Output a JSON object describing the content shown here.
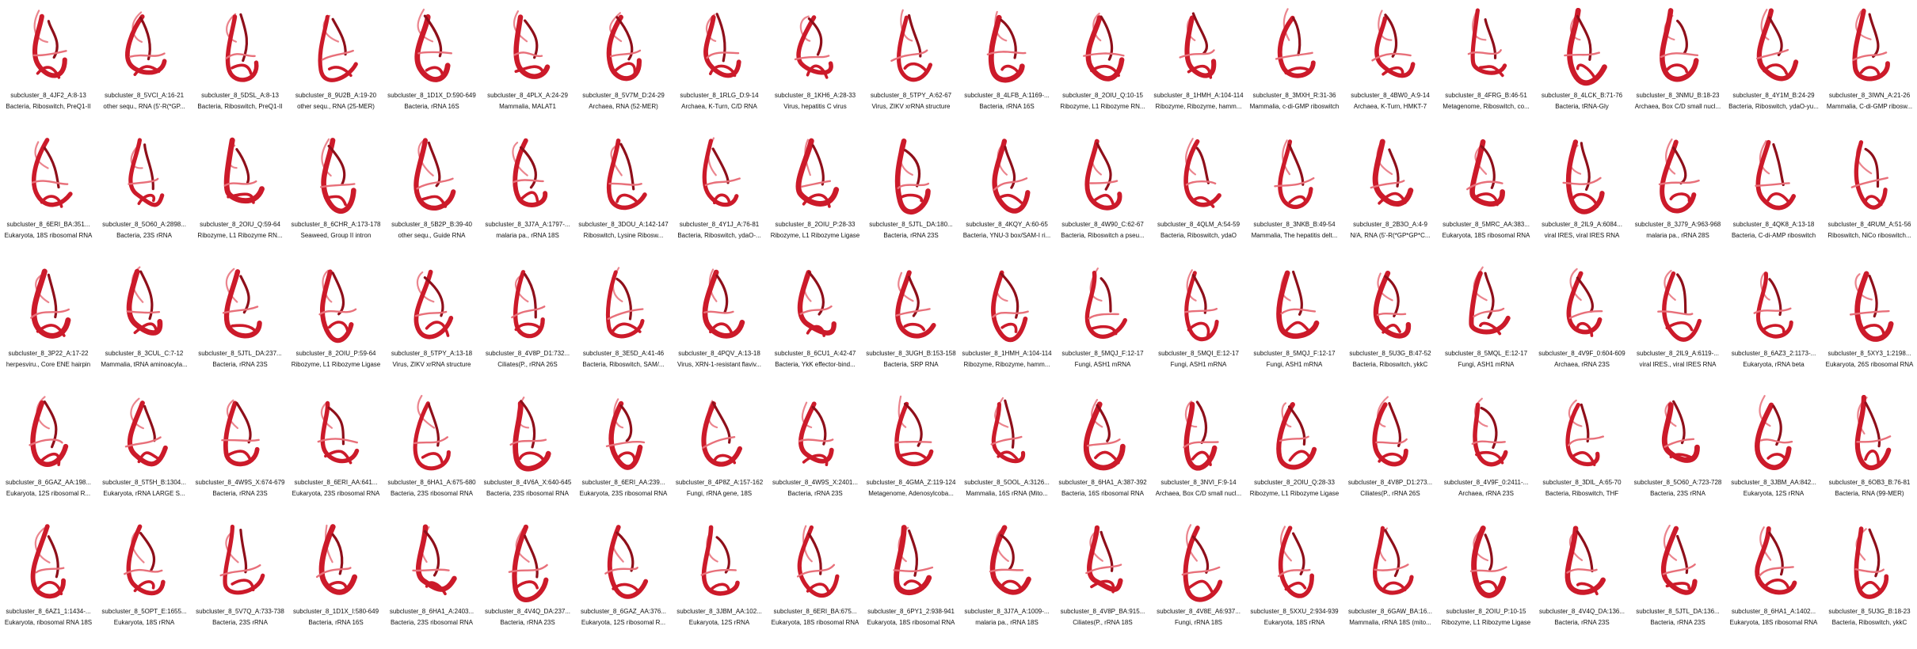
{
  "grid": {
    "cells": [
      {
        "title": "subcluster_8_4JF2_A:8-13",
        "subtitle": "Bacteria, Riboswitch, PreQ1-II"
      },
      {
        "title": "subcluster_8_5VCI_A:16-21",
        "subtitle": "other sequ., RNA (5'-R(*GP..."
      },
      {
        "title": "subcluster_8_5DSL_A:8-13",
        "subtitle": "Bacteria, Riboswitch, PreQ1-II"
      },
      {
        "title": "subcluster_8_9U2B_A:19-20",
        "subtitle": "other sequ., RNA (25-MER)"
      },
      {
        "title": "subcluster_8_1D1X_D:590-649",
        "subtitle": "Bacteria, rRNA 16S"
      },
      {
        "title": "subcluster_8_4PLX_A:24-29",
        "subtitle": "Mammalia, MALAT1"
      },
      {
        "title": "subcluster_8_5V7M_D:24-29",
        "subtitle": "Archaea, RNA (52-MER)"
      },
      {
        "title": "subcluster_8_1RLG_D:9-14",
        "subtitle": "Archaea, K-Turn, C/D RNA"
      },
      {
        "title": "subcluster_8_1KH6_A:28-33",
        "subtitle": "Virus, hepatitis C virus"
      },
      {
        "title": "subcluster_8_5TPY_A:62-67",
        "subtitle": "Virus, ZIKV xrRNA structure"
      },
      {
        "title": "subcluster_8_4LFB_A:1169-...",
        "subtitle": "Bacteria, rRNA 16S"
      },
      {
        "title": "subcluster_8_2OIU_Q:10-15",
        "subtitle": "Ribozyme, L1 Ribozyme RN..."
      },
      {
        "title": "subcluster_8_1HMH_A:104-114",
        "subtitle": "Ribozyme, Ribozyme, hamm..."
      },
      {
        "title": "subcluster_8_3MXH_R:31-36",
        "subtitle": "Mammalia, c-di-GMP riboswitch"
      },
      {
        "title": "subcluster_8_4BW0_A:9-14",
        "subtitle": "Archaea, K-Turn, HMKT-7"
      },
      {
        "title": "subcluster_8_4FRG_B:46-51",
        "subtitle": "Metagenome, Riboswitch, co..."
      },
      {
        "title": "subcluster_8_4LCK_B:71-76",
        "subtitle": "Bacteria, tRNA-Gly"
      },
      {
        "title": "subcluster_8_3NMU_B:18-23",
        "subtitle": "Archaea, Box C/D small nucl..."
      },
      {
        "title": "subcluster_8_4Y1M_B:24-29",
        "subtitle": "Bacteria, Riboswitch, ydaO-yu..."
      },
      {
        "title": "subcluster_8_3IWN_A:21-26",
        "subtitle": "Mammalia, C-di-GMP ribosw..."
      },
      {
        "title": "subcluster_8_6ERI_BA:351...",
        "subtitle": "Eukaryota, 18S ribosomal RNA"
      },
      {
        "title": "subcluster_8_5O60_A:2898...",
        "subtitle": "Bacteria, 23S rRNA"
      },
      {
        "title": "subcluster_8_2OIU_Q:59-64",
        "subtitle": "Ribozyme, L1 Ribozyme RN..."
      },
      {
        "title": "subcluster_8_6CHR_A:173-178",
        "subtitle": "Seaweed, Group II intron"
      },
      {
        "title": "subcluster_8_5B2P_B:39-40",
        "subtitle": "other sequ., Guide RNA"
      },
      {
        "title": "subcluster_8_3J7A_A:1797-...",
        "subtitle": "malaria pa., rRNA 18S"
      },
      {
        "title": "subcluster_8_3DOU_A:142-147",
        "subtitle": "Riboswitch, Lysine Ribosw..."
      },
      {
        "title": "subcluster_8_4Y1J_A:76-81",
        "subtitle": "Bacteria, Riboswitch, ydaO-..."
      },
      {
        "title": "subcluster_8_2OIU_P:28-33",
        "subtitle": "Ribozyme, L1 Ribozyme Ligase"
      },
      {
        "title": "subcluster_8_5JTL_DA:180...",
        "subtitle": "Bacteria, rRNA 23S"
      },
      {
        "title": "subcluster_8_4KQY_A:60-65",
        "subtitle": "Bacteria, YNU-3 box/SAM-I ri..."
      },
      {
        "title": "subcluster_8_4W90_C:62-67",
        "subtitle": "Bacteria, Riboswitch a pseu..."
      },
      {
        "title": "subcluster_8_4QLM_A:54-59",
        "subtitle": "Bacteria, Riboswitch, ydaO"
      },
      {
        "title": "subcluster_8_3NKB_B:49-54",
        "subtitle": "Mammalia, The hepatitis delt..."
      },
      {
        "title": "subcluster_8_2B3O_A:4-9",
        "subtitle": "N/A, RNA (5'-R(*GP*GP*C..."
      },
      {
        "title": "subcluster_8_5MRC_AA:383...",
        "subtitle": "Eukaryota, 18S ribosomal RNA"
      },
      {
        "title": "subcluster_8_2IL9_A:6084...",
        "subtitle": "viral IRES, viral IRES RNA"
      },
      {
        "title": "subcluster_8_3J79_A:963-968",
        "subtitle": "malaria pa., rRNA 28S"
      },
      {
        "title": "subcluster_8_4QK8_A:13-18",
        "subtitle": "Bacteria, C-di-AMP riboswitch"
      },
      {
        "title": "subcluster_8_4RUM_A:51-56",
        "subtitle": "Riboswitch, NiCo riboswitch..."
      },
      {
        "title": "subcluster_8_3P22_A:17-22",
        "subtitle": "herpesviru., Core ENE hairpin"
      },
      {
        "title": "subcluster_8_3CUL_C:7-12",
        "subtitle": "Mammalia, tRNA aminoacyla..."
      },
      {
        "title": "subcluster_8_5JTL_DA:237...",
        "subtitle": "Bacteria, rRNA 23S"
      },
      {
        "title": "subcluster_8_2OIU_P:59-64",
        "subtitle": "Ribozyme, L1 Ribozyme Ligase"
      },
      {
        "title": "subcluster_8_5TPY_A:13-18",
        "subtitle": "Virus, ZIKV xrRNA structure"
      },
      {
        "title": "subcluster_8_4V8P_D1:732...",
        "subtitle": "Ciliates(P., rRNA 26S"
      },
      {
        "title": "subcluster_8_3E5D_A:41-46",
        "subtitle": "Bacteria, Riboswitch, SAM/..."
      },
      {
        "title": "subcluster_8_4PQV_A:13-18",
        "subtitle": "Virus, XRN-1-resistant flaviv..."
      },
      {
        "title": "subcluster_8_6CU1_A:42-47",
        "subtitle": "Bacteria, YkK effector-bind..."
      },
      {
        "title": "subcluster_8_3UGH_B:153-158",
        "subtitle": "Bacteria, SRP RNA"
      },
      {
        "title": "subcluster_8_1HMH_A:104-114",
        "subtitle": "Ribozyme, Ribozyme, hamm..."
      },
      {
        "title": "subcluster_8_5MQJ_F:12-17",
        "subtitle": "Fungi, ASH1 mRNA"
      },
      {
        "title": "subcluster_8_5MQI_E:12-17",
        "subtitle": "Fungi, ASH1 mRNA"
      },
      {
        "title": "subcluster_8_5MQJ_F:12-17",
        "subtitle": "Fungi, ASH1 mRNA"
      },
      {
        "title": "subcluster_8_5U3G_B:47-52",
        "subtitle": "Bacteria, Riboswitch, ykkC"
      },
      {
        "title": "subcluster_8_5MQL_E:12-17",
        "subtitle": "Fungi, ASH1 mRNA"
      },
      {
        "title": "subcluster_8_4V9F_0:604-609",
        "subtitle": "Archaea, rRNA 23S"
      },
      {
        "title": "subcluster_8_2IL9_A:6119-...",
        "subtitle": "viral IRES., viral IRES RNA"
      },
      {
        "title": "subcluster_8_6AZ3_2:1173-...",
        "subtitle": "Eukaryota, rRNA beta"
      },
      {
        "title": "subcluster_8_5XY3_1:2198...",
        "subtitle": "Eukaryota, 26S ribosomal RNA"
      },
      {
        "title": "subcluster_8_6GAZ_AA:198...",
        "subtitle": "Eukaryota, 12S ribosomal R..."
      },
      {
        "title": "subcluster_8_5T5H_B:1304...",
        "subtitle": "Eukaryota, rRNA LARGE S..."
      },
      {
        "title": "subcluster_8_4W9S_X:674-679",
        "subtitle": "Bacteria, rRNA 23S"
      },
      {
        "title": "subcluster_8_6ERI_AA:641...",
        "subtitle": "Eukaryota, 23S ribosomal RNA"
      },
      {
        "title": "subcluster_8_6HA1_A:675-680",
        "subtitle": "Bacteria, 23S ribosomal RNA"
      },
      {
        "title": "subcluster_8_4V6A_X:640-645",
        "subtitle": "Bacteria, 23S ribosomal RNA"
      },
      {
        "title": "subcluster_8_6ERI_AA:239...",
        "subtitle": "Eukaryota, 23S ribosomal RNA"
      },
      {
        "title": "subcluster_8_4P8Z_A:157-162",
        "subtitle": "Fungi, rRNA gene, 18S"
      },
      {
        "title": "subcluster_8_4W9S_X:2401...",
        "subtitle": "Bacteria, rRNA 23S"
      },
      {
        "title": "subcluster_8_4GMA_Z:119-124",
        "subtitle": "Metagenome, Adenosylcoba..."
      },
      {
        "title": "subcluster_8_5OOL_A:3126...",
        "subtitle": "Mammalia, 16S rRNA (Mito..."
      },
      {
        "title": "subcluster_8_6HA1_A:387-392",
        "subtitle": "Bacteria, 16S ribosomal RNA"
      },
      {
        "title": "subcluster_8_3NVI_F:9-14",
        "subtitle": "Archaea, Box C/D small nucl..."
      },
      {
        "title": "subcluster_8_2OIU_Q:28-33",
        "subtitle": "Ribozyme, L1 Ribozyme Ligase"
      },
      {
        "title": "subcluster_8_4V8P_D1:273...",
        "subtitle": "Ciliates(P., rRNA 26S"
      },
      {
        "title": "subcluster_8_4V9F_0:2411-...",
        "subtitle": "Archaea, rRNA 23S"
      },
      {
        "title": "subcluster_8_3DIL_A:65-70",
        "subtitle": "Bacteria, Riboswitch, THF"
      },
      {
        "title": "subcluster_8_5O60_A:723-728",
        "subtitle": "Bacteria, 23S rRNA"
      },
      {
        "title": "subcluster_8_3JBM_AA:842...",
        "subtitle": "Eukaryota, 12S rRNA"
      },
      {
        "title": "subcluster_8_6OB3_B:76-81",
        "subtitle": "Bacteria, RNA (99-MER)"
      },
      {
        "title": "subcluster_8_6AZ1_1:1434-...",
        "subtitle": "Eukaryota, ribosomal RNA 18S"
      },
      {
        "title": "subcluster_8_5OPT_E:1655...",
        "subtitle": "Eukaryota, 18S rRNA"
      },
      {
        "title": "subcluster_8_5V7Q_A:733-738",
        "subtitle": "Bacteria, 23S rRNA"
      },
      {
        "title": "subcluster_8_1D1X_I:580-649",
        "subtitle": "Bacteria, rRNA 16S"
      },
      {
        "title": "subcluster_8_6HA1_A:2403...",
        "subtitle": "Bacteria, 23S ribosomal RNA"
      },
      {
        "title": "subcluster_8_4V4Q_DA:237...",
        "subtitle": "Bacteria, rRNA 23S"
      },
      {
        "title": "subcluster_8_6GAZ_AA:376...",
        "subtitle": "Eukaryota, 12S ribosomal R..."
      },
      {
        "title": "subcluster_8_3JBM_AA:102...",
        "subtitle": "Eukaryota, 12S rRNA"
      },
      {
        "title": "subcluster_8_6ERI_BA:675...",
        "subtitle": "Eukaryota, 18S ribosomal RNA"
      },
      {
        "title": "subcluster_8_6PY1_2:938-941",
        "subtitle": "Eukaryota, 18S ribosomal RNA"
      },
      {
        "title": "subcluster_8_3J7A_A:1009-...",
        "subtitle": "malaria pa., rRNA 18S"
      },
      {
        "title": "subcluster_8_4V8P_BA:915...",
        "subtitle": "Ciliates(P., rRNA 18S"
      },
      {
        "title": "subcluster_8_4V8E_A6:937...",
        "subtitle": "Fungi, rRNA 18S"
      },
      {
        "title": "subcluster_8_5XXU_2:934-939",
        "subtitle": "Eukaryota, 18S rRNA"
      },
      {
        "title": "subcluster_8_6GAW_BA:16...",
        "subtitle": "Mammalia, rRNA 18S (mito..."
      },
      {
        "title": "subcluster_8_2OIU_P:10-15",
        "subtitle": "Ribozyme, L1 Ribozyme Ligase"
      },
      {
        "title": "subcluster_8_4V4Q_DA:136...",
        "subtitle": "Bacteria, rRNA 23S"
      },
      {
        "title": "subcluster_8_5JTL_DA:136...",
        "subtitle": "Bacteria, rRNA 23S"
      },
      {
        "title": "subcluster_8_6HA1_A:1402...",
        "subtitle": "Eukaryota, 18S ribosomal RNA"
      },
      {
        "title": "subcluster_8_5U3G_B:18-23",
        "subtitle": "Bacteria, Riboswitch, ykkC"
      }
    ]
  },
  "style": {
    "strand_color": "#cc1a2a",
    "strand_light": "#e8707a",
    "strand_dark": "#8f0f1a",
    "icon": "rna-backbone-structure-icon"
  }
}
